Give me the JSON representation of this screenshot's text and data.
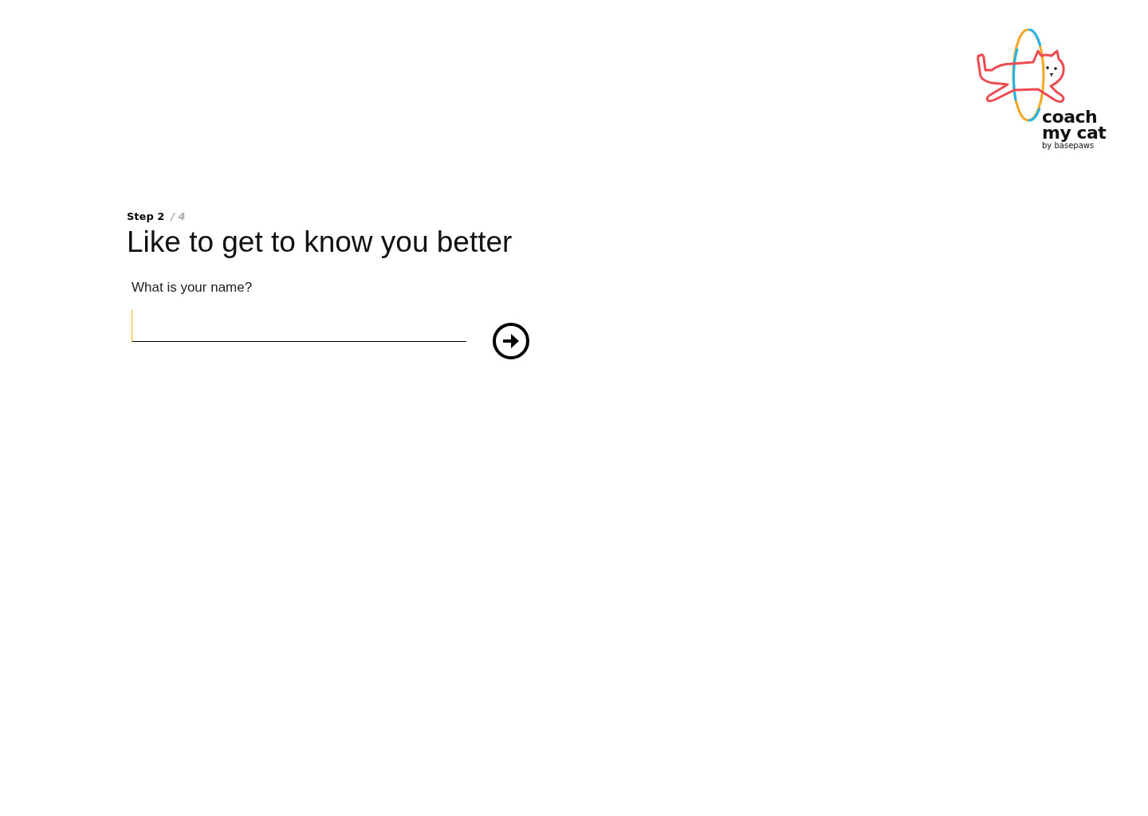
{
  "logo": {
    "line_1": "coach",
    "line_2": "my cat",
    "byline": "by basepaws"
  },
  "step": {
    "current": "Step 2",
    "total": "/ 4"
  },
  "heading": "Like to get to know you better",
  "question": {
    "label": "What is your name?"
  }
}
